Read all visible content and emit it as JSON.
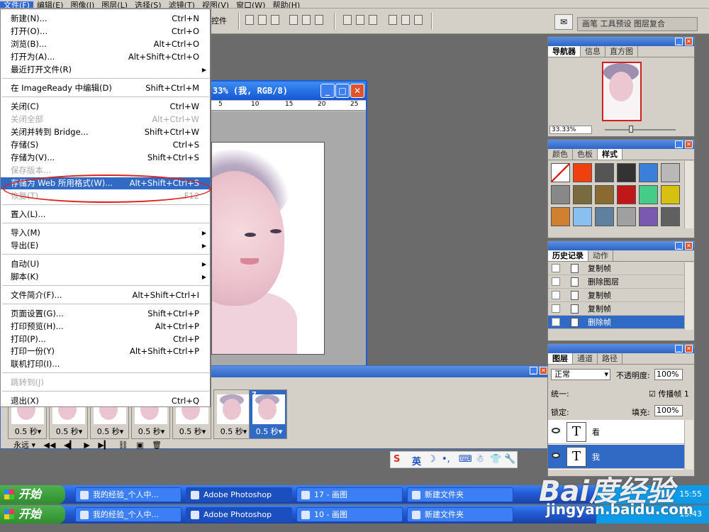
{
  "menubar": {
    "items": [
      "文件(F)",
      "编辑(E)",
      "图像(I)",
      "图层(L)",
      "选择(S)",
      "滤镜(T)",
      "视图(V)",
      "窗口(W)",
      "帮助(H)"
    ]
  },
  "options": {
    "label": "控件",
    "dock_text": "画笔 工具预设 图层复合"
  },
  "document": {
    "title": "33% (我, RGB/8)",
    "ruler_ticks": [
      "5",
      "10",
      "15",
      "20",
      "25"
    ]
  },
  "file_menu": {
    "items": [
      {
        "label": "新建(N)...",
        "shortcut": "Ctrl+N"
      },
      {
        "label": "打开(O)...",
        "shortcut": "Ctrl+O"
      },
      {
        "label": "浏览(B)...",
        "shortcut": "Alt+Ctrl+O"
      },
      {
        "label": "打开为(A)...",
        "shortcut": "Alt+Shift+Ctrl+O"
      },
      {
        "label": "最近打开文件(R)",
        "shortcut": ""
      },
      {
        "label": "在 ImageReady 中编辑(D)",
        "shortcut": "Shift+Ctrl+M"
      },
      {
        "label": "关闭(C)",
        "shortcut": "Ctrl+W"
      },
      {
        "label": "关闭全部",
        "shortcut": "Alt+Ctrl+W"
      },
      {
        "label": "关闭并转到 Bridge...",
        "shortcut": "Shift+Ctrl+W"
      },
      {
        "label": "存储(S)",
        "shortcut": "Ctrl+S"
      },
      {
        "label": "存储为(V)...",
        "shortcut": "Shift+Ctrl+S"
      },
      {
        "label": "保存版本...",
        "shortcut": ""
      },
      {
        "label": "存储为 Web 所用格式(W)...",
        "shortcut": "Alt+Shift+Ctrl+S"
      },
      {
        "label": "恢复(T)",
        "shortcut": "F12"
      },
      {
        "label": "置入(L)...",
        "shortcut": ""
      },
      {
        "label": "导入(M)",
        "shortcut": ""
      },
      {
        "label": "导出(E)",
        "shortcut": ""
      },
      {
        "label": "自动(U)",
        "shortcut": ""
      },
      {
        "label": "脚本(K)",
        "shortcut": ""
      },
      {
        "label": "文件简介(F)...",
        "shortcut": "Alt+Shift+Ctrl+I"
      },
      {
        "label": "页面设置(G)...",
        "shortcut": "Shift+Ctrl+P"
      },
      {
        "label": "打印预览(H)...",
        "shortcut": "Alt+Ctrl+P"
      },
      {
        "label": "打印(P)...",
        "shortcut": "Ctrl+P"
      },
      {
        "label": "打印一份(Y)",
        "shortcut": "Alt+Shift+Ctrl+P"
      },
      {
        "label": "联机打印(I)...",
        "shortcut": ""
      },
      {
        "label": "跳转到(J)",
        "shortcut": ""
      },
      {
        "label": "退出(X)",
        "shortcut": "Ctrl+Q"
      }
    ]
  },
  "animation": {
    "frames": [
      {
        "num": "",
        "duration": "0.5 秒▾"
      },
      {
        "num": "",
        "duration": "0.5 秒▾"
      },
      {
        "num": "",
        "duration": "0.5 秒▾"
      },
      {
        "num": "",
        "duration": "0.5 秒▾"
      },
      {
        "num": "",
        "duration": "0.5 秒▾"
      },
      {
        "num": "",
        "duration": "0.5 秒▾"
      },
      {
        "num": "7",
        "duration": "0.5 秒▾"
      }
    ],
    "loop": "永远 ▾",
    "controls": [
      "◀◀",
      "◀▎",
      "▶",
      "▶▎"
    ]
  },
  "navigator": {
    "tabs": [
      "导航器",
      "信息",
      "直方图"
    ],
    "zoom": "33.33%"
  },
  "styles": {
    "tabs": [
      "颜色",
      "色板",
      "样式"
    ],
    "swatches": [
      "#ffffff",
      "#f04010",
      "#555555",
      "#333333",
      "#3a7fd8",
      "#b8b8b8",
      "#888888",
      "#7a6a40",
      "#8a6a30",
      "#c01818",
      "#4c8",
      "#d8c010",
      "#d08030",
      "#8ac0f0",
      "#6080a0",
      "#a0a0a0",
      "#7a5ab0",
      "#606060"
    ]
  },
  "history": {
    "tabs": [
      "历史记录",
      "动作"
    ],
    "items": [
      "复制帧",
      "删除图层",
      "复制帧",
      "复制帧",
      "删除帧"
    ]
  },
  "layers": {
    "tabs": [
      "图层",
      "通道",
      "路径"
    ],
    "blend": "正常",
    "opacity_label": "不透明度:",
    "opacity": "100%",
    "unify_label": "统一:",
    "propagate": "传播帧 1",
    "lock_label": "锁定:",
    "fill_label": "填充:",
    "fill": "100%",
    "items": [
      {
        "name": "看"
      },
      {
        "name": "我"
      }
    ]
  },
  "ime": {
    "items": [
      "英",
      "☽",
      "•,",
      "⌨",
      "☃",
      "👕",
      "🔧"
    ]
  },
  "taskbars": [
    {
      "start": "开始",
      "buttons": [
        "我的经验_个人中...",
        "Adobe Photoshop",
        "17 - 画图",
        "新建文件夹"
      ],
      "time": "15:55"
    },
    {
      "start": "开始",
      "buttons": [
        "我的经验_个人中...",
        "Adobe Photoshop",
        "10 - 画图",
        "新建文件夹"
      ],
      "time": "15:43"
    }
  ],
  "watermark": {
    "logo": "Bai度经验",
    "url": "jingyan.baidu.com"
  }
}
